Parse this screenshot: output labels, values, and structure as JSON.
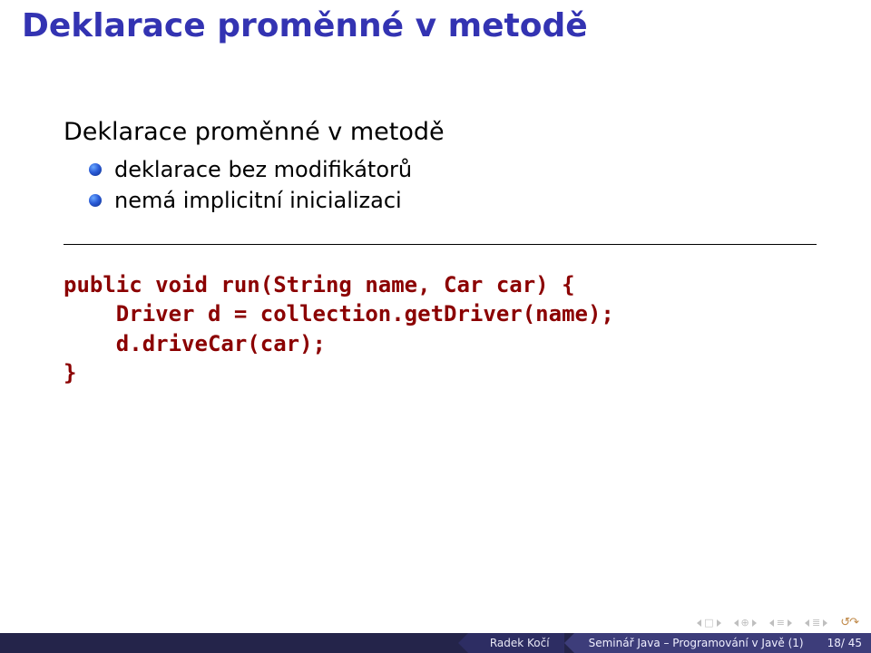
{
  "title": "Deklarace proměnné v metodě",
  "subhead": "Deklarace proměnné v metodě",
  "bullets": [
    "deklarace bez modifikátorů",
    "nemá implicitní inicializaci"
  ],
  "code": "public void run(String name, Car car) {\n    Driver d = collection.getDriver(name);\n    d.driveCar(car);\n}",
  "footer": {
    "author": "Radek Kočí",
    "lecture": "Seminář Java – Programování v Javě (1)",
    "page": "18/ 45"
  },
  "nav_icons": {
    "first": "first-slide-icon",
    "prev": "prev-slide-icon",
    "prev_section": "prev-section-icon",
    "next_section": "next-section-icon",
    "next": "next-slide-icon",
    "last": "last-slide-icon",
    "loop": "loop-icon",
    "square": "□",
    "overlay": "⊕",
    "lines": "≡",
    "lines2": "≣"
  }
}
